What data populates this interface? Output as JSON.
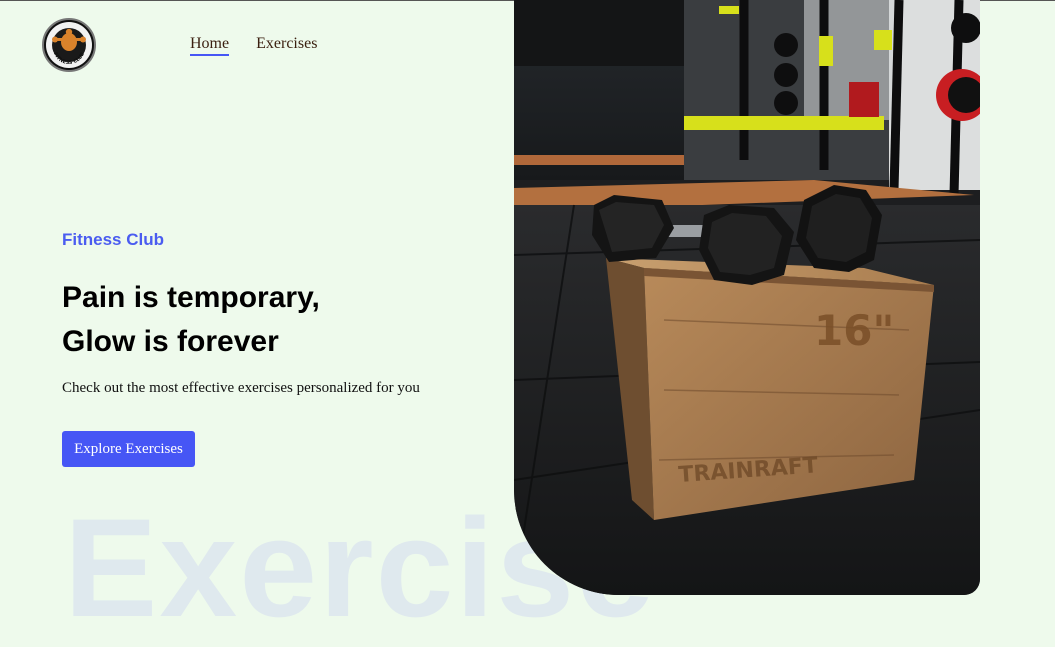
{
  "logo": {
    "text": "FITNESS CLUB"
  },
  "nav": {
    "home": "Home",
    "exercises": "Exercises"
  },
  "hero": {
    "eyebrow": "Fitness Club",
    "headline_line1": "Pain is temporary,",
    "headline_line2": "Glow is forever",
    "description": "Check out the most effective exercises personalized for you",
    "cta_label": "Explore Exercises",
    "background_word": "Exercise",
    "box_label": "16\"",
    "box_brand": "TRAINRAFT"
  },
  "colors": {
    "page_bg": "#eefaec",
    "accent": "#4656f5",
    "background_word": "#dfe9ee"
  }
}
